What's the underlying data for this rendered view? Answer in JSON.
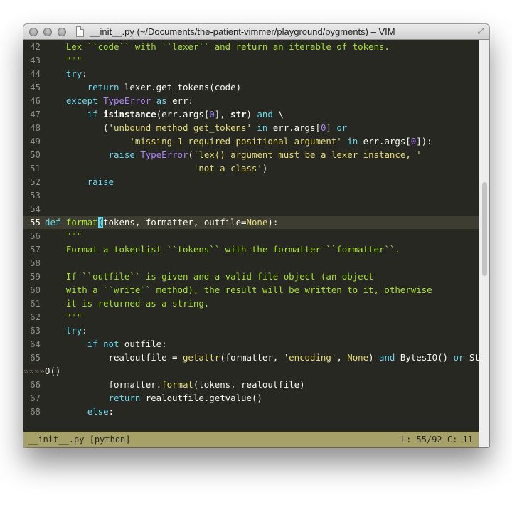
{
  "window": {
    "title": "__init__.py (~/Documents/the-patient-vimmer/playground/pygments) – VIM",
    "resize_glyph": "⤢"
  },
  "editor": {
    "wrap_marker": "»»»»",
    "lines": [
      {
        "n": "42",
        "segs": [
          {
            "t": "    ",
            "c": ""
          },
          {
            "t": "Lex ``code`` with ``lexer`` and return an iterable of tokens.",
            "c": "c"
          }
        ]
      },
      {
        "n": "43",
        "segs": [
          {
            "t": "    ",
            "c": ""
          },
          {
            "t": "\"\"\"",
            "c": "c"
          }
        ]
      },
      {
        "n": "44",
        "segs": [
          {
            "t": "    ",
            "c": ""
          },
          {
            "t": "try",
            "c": "k"
          },
          {
            "t": ":",
            "c": "o"
          }
        ]
      },
      {
        "n": "45",
        "segs": [
          {
            "t": "        ",
            "c": ""
          },
          {
            "t": "return",
            "c": "k"
          },
          {
            "t": " lexer.get_tokens(code)",
            "c": "o"
          }
        ]
      },
      {
        "n": "46",
        "segs": [
          {
            "t": "    ",
            "c": ""
          },
          {
            "t": "except",
            "c": "k"
          },
          {
            "t": " ",
            "c": ""
          },
          {
            "t": "TypeError",
            "c": "ex"
          },
          {
            "t": " ",
            "c": ""
          },
          {
            "t": "as",
            "c": "k"
          },
          {
            "t": " err:",
            "c": "o"
          }
        ]
      },
      {
        "n": "47",
        "segs": [
          {
            "t": "        ",
            "c": ""
          },
          {
            "t": "if",
            "c": "k"
          },
          {
            "t": " ",
            "c": ""
          },
          {
            "t": "isinstance",
            "c": "b"
          },
          {
            "t": "(err.args[",
            "c": "o"
          },
          {
            "t": "0",
            "c": "n"
          },
          {
            "t": "], ",
            "c": "o"
          },
          {
            "t": "str",
            "c": "b"
          },
          {
            "t": ") ",
            "c": "o"
          },
          {
            "t": "and",
            "c": "k"
          },
          {
            "t": " \\",
            "c": "o"
          }
        ]
      },
      {
        "n": "48",
        "segs": [
          {
            "t": "           (",
            "c": "o"
          },
          {
            "t": "'unbound method get_tokens'",
            "c": "s"
          },
          {
            "t": " ",
            "c": ""
          },
          {
            "t": "in",
            "c": "k"
          },
          {
            "t": " err.args[",
            "c": "o"
          },
          {
            "t": "0",
            "c": "n"
          },
          {
            "t": "] ",
            "c": "o"
          },
          {
            "t": "or",
            "c": "k"
          }
        ]
      },
      {
        "n": "49",
        "segs": [
          {
            "t": "                ",
            "c": ""
          },
          {
            "t": "'missing 1 required positional argument'",
            "c": "s"
          },
          {
            "t": " ",
            "c": ""
          },
          {
            "t": "in",
            "c": "k"
          },
          {
            "t": " err.args[",
            "c": "o"
          },
          {
            "t": "0",
            "c": "n"
          },
          {
            "t": "]):",
            "c": "o"
          }
        ]
      },
      {
        "n": "50",
        "segs": [
          {
            "t": "            ",
            "c": ""
          },
          {
            "t": "raise",
            "c": "k"
          },
          {
            "t": " ",
            "c": ""
          },
          {
            "t": "TypeError",
            "c": "ex"
          },
          {
            "t": "(",
            "c": "o"
          },
          {
            "t": "'lex() argument must be a lexer instance, '",
            "c": "s"
          }
        ]
      },
      {
        "n": "51",
        "segs": [
          {
            "t": "                            ",
            "c": ""
          },
          {
            "t": "'not a class'",
            "c": "s"
          },
          {
            "t": ")",
            "c": "o"
          }
        ]
      },
      {
        "n": "52",
        "segs": [
          {
            "t": "        ",
            "c": ""
          },
          {
            "t": "raise",
            "c": "k"
          }
        ]
      },
      {
        "n": "53",
        "segs": []
      },
      {
        "n": "54",
        "segs": []
      },
      {
        "n": "55",
        "cur": true,
        "segs": [
          {
            "t": "def",
            "c": "k"
          },
          {
            "t": " ",
            "c": ""
          },
          {
            "t": "format",
            "c": "f"
          },
          {
            "t": "(",
            "c": "cursor"
          },
          {
            "t": "tokens, formatter, outfile=",
            "c": "o"
          },
          {
            "t": "None",
            "c": "fn"
          },
          {
            "t": "):",
            "c": "o"
          }
        ]
      },
      {
        "n": "56",
        "segs": [
          {
            "t": "    ",
            "c": ""
          },
          {
            "t": "\"\"\"",
            "c": "c"
          }
        ]
      },
      {
        "n": "57",
        "segs": [
          {
            "t": "    ",
            "c": ""
          },
          {
            "t": "Format a tokenlist ``tokens`` with the formatter ``formatter``.",
            "c": "c"
          }
        ]
      },
      {
        "n": "58",
        "segs": []
      },
      {
        "n": "59",
        "segs": [
          {
            "t": "    ",
            "c": ""
          },
          {
            "t": "If ``outfile`` is given and a valid file object (an object",
            "c": "c"
          }
        ]
      },
      {
        "n": "60",
        "segs": [
          {
            "t": "    ",
            "c": ""
          },
          {
            "t": "with a ``write`` method), the result will be written to it, otherwise",
            "c": "c"
          }
        ]
      },
      {
        "n": "61",
        "segs": [
          {
            "t": "    ",
            "c": ""
          },
          {
            "t": "it is returned as a string.",
            "c": "c"
          }
        ]
      },
      {
        "n": "62",
        "segs": [
          {
            "t": "    ",
            "c": ""
          },
          {
            "t": "\"\"\"",
            "c": "c"
          }
        ]
      },
      {
        "n": "63",
        "segs": [
          {
            "t": "    ",
            "c": ""
          },
          {
            "t": "try",
            "c": "k"
          },
          {
            "t": ":",
            "c": "o"
          }
        ]
      },
      {
        "n": "64",
        "segs": [
          {
            "t": "        ",
            "c": ""
          },
          {
            "t": "if",
            "c": "k"
          },
          {
            "t": " ",
            "c": ""
          },
          {
            "t": "not",
            "c": "k"
          },
          {
            "t": " outfile:",
            "c": "o"
          }
        ]
      },
      {
        "n": "65",
        "segs": [
          {
            "t": "            realoutfile = ",
            "c": "o"
          },
          {
            "t": "getattr",
            "c": "fn"
          },
          {
            "t": "(formatter, ",
            "c": "o"
          },
          {
            "t": "'encoding'",
            "c": "s"
          },
          {
            "t": ", ",
            "c": "o"
          },
          {
            "t": "None",
            "c": "fn"
          },
          {
            "t": ") ",
            "c": "o"
          },
          {
            "t": "and",
            "c": "k"
          },
          {
            "t": " BytesIO() ",
            "c": "o"
          },
          {
            "t": "or",
            "c": "k"
          },
          {
            "t": " StringI",
            "c": "o"
          }
        ]
      },
      {
        "n": "",
        "wrap": true,
        "segs": [
          {
            "t": "O()",
            "c": "o"
          }
        ]
      },
      {
        "n": "66",
        "segs": [
          {
            "t": "            formatter.",
            "c": "o"
          },
          {
            "t": "format",
            "c": "fn"
          },
          {
            "t": "(tokens, realoutfile)",
            "c": "o"
          }
        ]
      },
      {
        "n": "67",
        "segs": [
          {
            "t": "            ",
            "c": ""
          },
          {
            "t": "return",
            "c": "k"
          },
          {
            "t": " realoutfile.getvalue()",
            "c": "o"
          }
        ]
      },
      {
        "n": "68",
        "segs": [
          {
            "t": "        ",
            "c": ""
          },
          {
            "t": "else",
            "c": "k"
          },
          {
            "t": ":",
            "c": "o"
          }
        ]
      }
    ]
  },
  "statusbar": {
    "filename": "__init__.py [python]",
    "position": "L: 55/92 C: 11"
  },
  "colors": {
    "background": "#272822",
    "statusbar": "#a6a169",
    "keyword": "#66d9ef",
    "string": "#e6db74",
    "number": "#ae81ff",
    "docstring": "#a6e22e"
  }
}
